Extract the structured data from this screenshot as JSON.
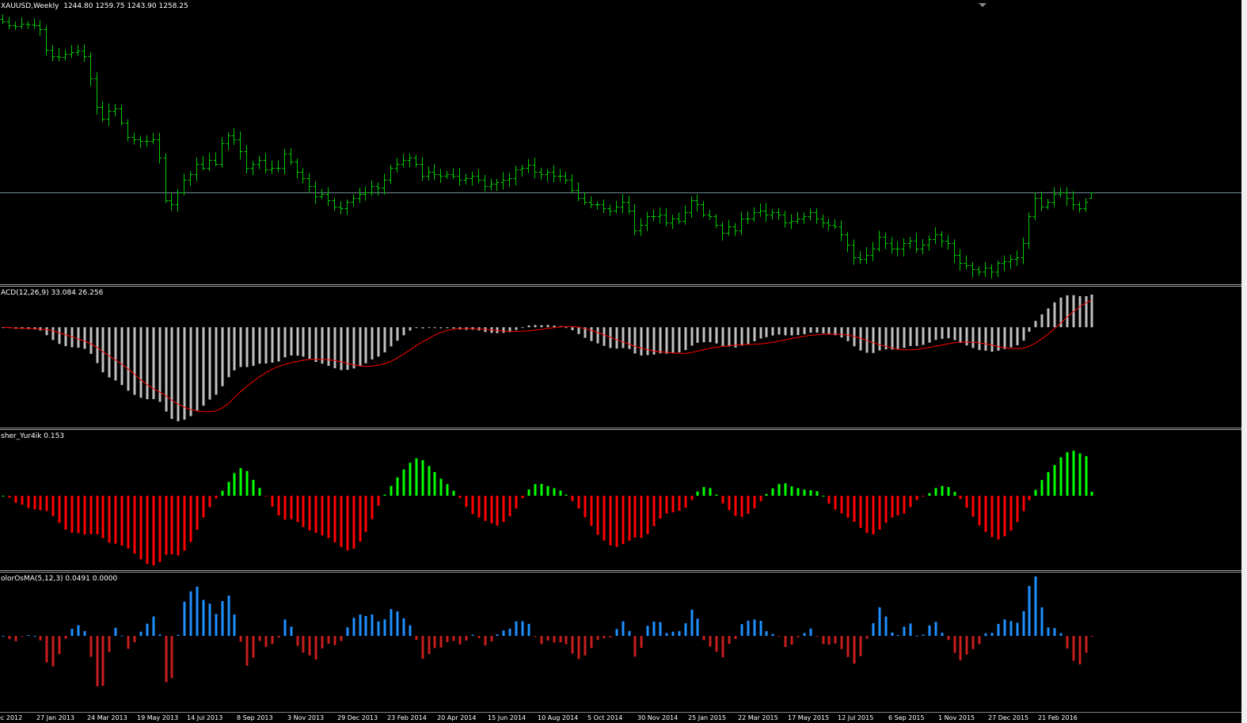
{
  "panels": {
    "price": {
      "label": "XAUUSD,Weekly",
      "ohlc": "1244.80 1259.75 1243.90 1258.25"
    },
    "macd": {
      "label": "ACD(12,26,9) 33.084 26.256"
    },
    "fisher": {
      "label": "sher_Yur4ik 0.153"
    },
    "osma": {
      "label": "olorOsMA(5,12,3) 0.0491 0.0000"
    }
  },
  "time_axis": {
    "labels": [
      "ec 2012",
      "27 Jan 2013",
      "24 Mar 2013",
      "19 May 2013",
      "14 Jul 2013",
      "8 Sep 2013",
      "3 Nov 2013",
      "29 Dec 2013",
      "23 Feb 2014",
      "20 Apr 2014",
      "15 Jun 2014",
      "10 Aug 2014",
      "5 Oct 2014",
      "30 Nov 2014",
      "25 Jan 2015",
      "22 Mar 2015",
      "17 May 2015",
      "12 Jul 2015",
      "6 Sep 2015",
      "1 Nov 2015",
      "27 Dec 2015",
      "21 Feb 2016"
    ]
  },
  "colors": {
    "background": "#000000",
    "bars": "#00c800",
    "macd_histogram": "#c0c0c0",
    "macd_signal": "#ff0000",
    "fisher_positive": "#00ff00",
    "fisher_negative": "#ff0000",
    "osma_positive": "#1e90ff",
    "osma_negative": "#c81e1e",
    "current_price_line": "#6f8f94"
  },
  "chart_data": [
    {
      "type": "ohlc",
      "symbol": "XAUUSD",
      "timeframe": "Weekly",
      "last_bar": {
        "open": 1244.8,
        "high": 1259.75,
        "low": 1243.9,
        "close": 1258.25
      },
      "close": [
        1680,
        1670,
        1668,
        1674,
        1672,
        1671,
        1660,
        1610,
        1595,
        1592,
        1600,
        1605,
        1608,
        1595,
        1540,
        1470,
        1440,
        1460,
        1465,
        1430,
        1395,
        1390,
        1385,
        1385,
        1390,
        1345,
        1240,
        1230,
        1260,
        1290,
        1305,
        1330,
        1320,
        1340,
        1330,
        1380,
        1400,
        1390,
        1360,
        1320,
        1330,
        1340,
        1315,
        1320,
        1320,
        1355,
        1335,
        1310,
        1295,
        1275,
        1250,
        1255,
        1240,
        1225,
        1220,
        1235,
        1245,
        1255,
        1260,
        1275,
        1270,
        1290,
        1320,
        1330,
        1340,
        1345,
        1330,
        1300,
        1310,
        1305,
        1300,
        1305,
        1300,
        1290,
        1295,
        1300,
        1290,
        1275,
        1280,
        1285,
        1290,
        1295,
        1315,
        1320,
        1328,
        1310,
        1305,
        1310,
        1300,
        1300,
        1290,
        1265,
        1245,
        1235,
        1230,
        1230,
        1220,
        1215,
        1225,
        1235,
        1215,
        1165,
        1180,
        1200,
        1200,
        1205,
        1185,
        1195,
        1190,
        1210,
        1240,
        1230,
        1205,
        1200,
        1180,
        1160,
        1175,
        1165,
        1195,
        1195,
        1210,
        1215,
        1205,
        1210,
        1205,
        1185,
        1190,
        1195,
        1200,
        1210,
        1195,
        1185,
        1180,
        1175,
        1155,
        1130,
        1100,
        1095,
        1105,
        1120,
        1150,
        1135,
        1120,
        1120,
        1135,
        1140,
        1120,
        1130,
        1145,
        1155,
        1140,
        1135,
        1105,
        1085,
        1080,
        1070,
        1065,
        1075,
        1065,
        1085,
        1090,
        1095,
        1100,
        1135,
        1200,
        1245,
        1225,
        1235,
        1255,
        1260,
        1245,
        1230,
        1220,
        1235,
        1258
      ]
    },
    {
      "type": "bar",
      "name": "ACD(12,26,9)",
      "values_label": [
        "33.084",
        "26.256"
      ]
    },
    {
      "type": "bar",
      "name": "sher_Yur4ik",
      "value": 0.153
    },
    {
      "type": "bar",
      "name": "olorOsMA(5,12,3)",
      "values_label": [
        "0.0491",
        "0.0000"
      ]
    }
  ]
}
